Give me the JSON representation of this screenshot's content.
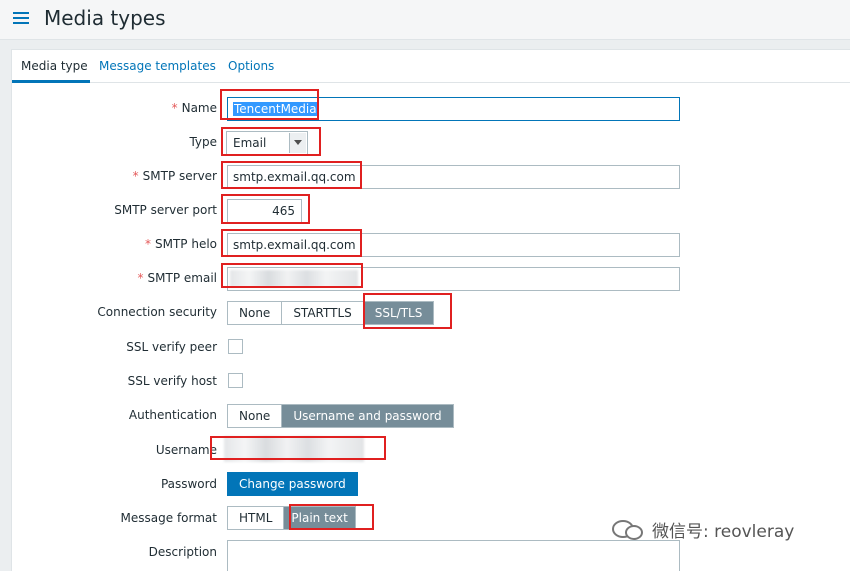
{
  "header": {
    "title": "Media types",
    "menu_icon": "hamburger-menu-icon"
  },
  "tabs": [
    {
      "label": "Media type",
      "active": true
    },
    {
      "label": "Message templates",
      "active": false
    },
    {
      "label": "Options",
      "active": false
    }
  ],
  "form": {
    "name": {
      "label": "Name",
      "required": "*",
      "value": "TencentMedia"
    },
    "type": {
      "label": "Type",
      "value": "Email"
    },
    "smtp_server": {
      "label": "SMTP server",
      "required": "*",
      "value": "smtp.exmail.qq.com"
    },
    "smtp_port": {
      "label": "SMTP server port",
      "value": "465"
    },
    "smtp_helo": {
      "label": "SMTP helo",
      "required": "*",
      "value": "smtp.exmail.qq.com"
    },
    "smtp_email": {
      "label": "SMTP email",
      "required": "*"
    },
    "connection_security": {
      "label": "Connection security",
      "options": [
        "None",
        "STARTTLS",
        "SSL/TLS"
      ],
      "selected": "SSL/TLS"
    },
    "ssl_verify_peer": {
      "label": "SSL verify peer",
      "checked": false
    },
    "ssl_verify_host": {
      "label": "SSL verify host",
      "checked": false
    },
    "authentication": {
      "label": "Authentication",
      "options": [
        "None",
        "Username and password"
      ],
      "selected": "Username and password"
    },
    "username": {
      "label": "Username"
    },
    "password": {
      "label": "Password",
      "button": "Change password"
    },
    "message_format": {
      "label": "Message format",
      "options": [
        "HTML",
        "Plain text"
      ],
      "selected": "Plain text"
    },
    "description": {
      "label": "Description"
    }
  },
  "watermark": {
    "text": "微信号: reovleray"
  },
  "colors": {
    "accent": "#0275b8",
    "highlight_box": "#e02020",
    "selected_segment": "#768d99",
    "required": "#e45959"
  }
}
